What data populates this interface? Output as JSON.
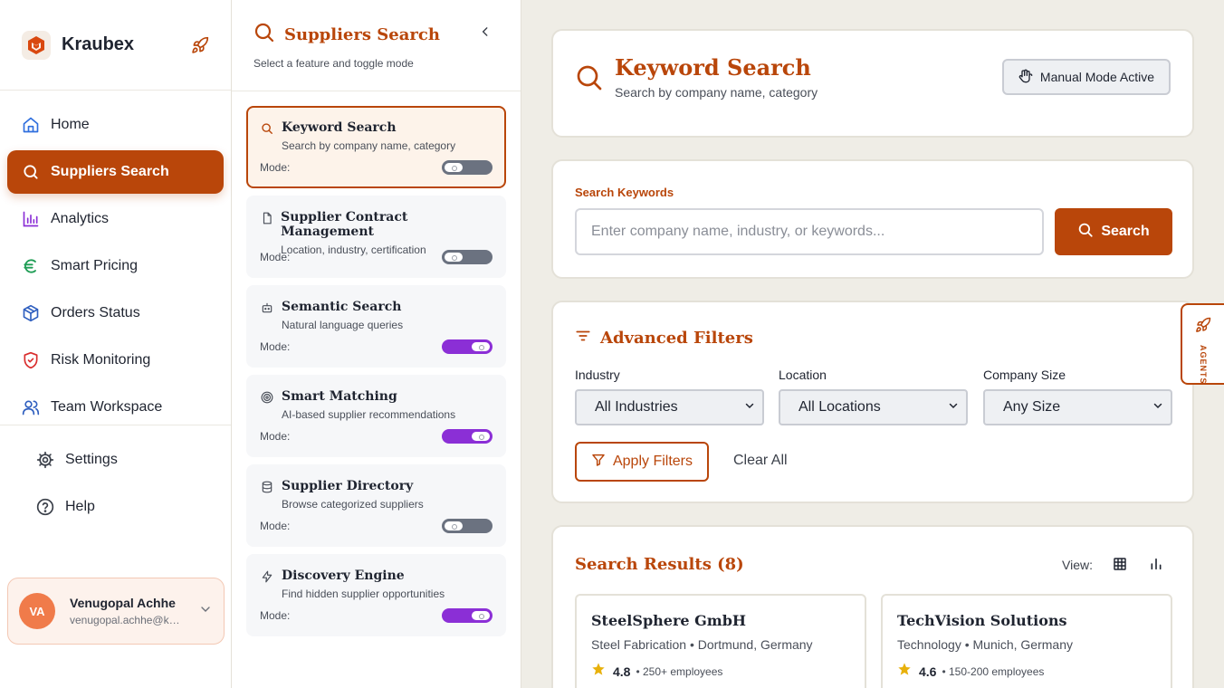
{
  "app": {
    "name": "Kraubex"
  },
  "sidebar": {
    "items": [
      {
        "label": "Home",
        "icon": "home-icon"
      },
      {
        "label": "Suppliers Search",
        "icon": "search-icon",
        "active": true
      },
      {
        "label": "Analytics",
        "icon": "bar-chart-icon"
      },
      {
        "label": "Smart Pricing",
        "icon": "euro-icon"
      },
      {
        "label": "Orders Status",
        "icon": "package-icon"
      },
      {
        "label": "Risk Monitoring",
        "icon": "shield-alert-icon"
      },
      {
        "label": "Team Workspace",
        "icon": "users-icon"
      }
    ],
    "bottom_items": [
      {
        "label": "Settings",
        "icon": "gear-icon"
      },
      {
        "label": "Help",
        "icon": "help-circle-icon"
      }
    ],
    "user": {
      "initials": "VA",
      "name": "Venugopal Achhe",
      "email": "venugopal.achhe@kraubex.com"
    }
  },
  "feature_panel": {
    "title": "Suppliers Search",
    "subtitle": "Select a feature and toggle mode",
    "mode_label": "Mode:",
    "features": [
      {
        "title": "Keyword Search",
        "desc": "Search by company name, category",
        "icon": "search-icon",
        "mode_on": false,
        "active": true
      },
      {
        "title": "Supplier Contract Management",
        "desc": "Location, industry, certification",
        "icon": "document-icon",
        "mode_on": false
      },
      {
        "title": "Semantic Search",
        "desc": "Natural language queries",
        "icon": "bot-icon",
        "mode_on": true
      },
      {
        "title": "Smart Matching",
        "desc": "AI-based supplier recommendations",
        "icon": "target-icon",
        "mode_on": true
      },
      {
        "title": "Supplier Directory",
        "desc": "Browse categorized suppliers",
        "icon": "database-icon",
        "mode_on": false
      },
      {
        "title": "Discovery Engine",
        "desc": "Find hidden supplier opportunities",
        "icon": "lightning-icon",
        "mode_on": true
      }
    ]
  },
  "header": {
    "title": "Keyword Search",
    "subtitle": "Search by company name, category",
    "mode_button": "Manual Mode Active"
  },
  "search": {
    "label": "Search Keywords",
    "placeholder": "Enter company name, industry, or keywords...",
    "button": "Search"
  },
  "filters": {
    "title": "Advanced Filters",
    "fields": [
      {
        "label": "Industry",
        "value": "All Industries"
      },
      {
        "label": "Location",
        "value": "All Locations"
      },
      {
        "label": "Company Size",
        "value": "Any Size"
      }
    ],
    "apply": "Apply Filters",
    "clear": "Clear All"
  },
  "results": {
    "title": "Search Results (8)",
    "view_label": "View:",
    "items": [
      {
        "name": "SteelSphere GmbH",
        "meta": "Steel Fabrication • Dortmund, Germany",
        "rating": "4.8",
        "employees": "• 250+ employees"
      },
      {
        "name": "TechVision Solutions",
        "meta": "Technology • Munich, Germany",
        "rating": "4.6",
        "employees": "• 150-200 employees"
      }
    ]
  },
  "agents_tab": {
    "label": "AGENTS"
  },
  "colors": {
    "accent": "#b9460a",
    "toggle_on": "#8b2fd6",
    "toggle_off": "#6b7280",
    "star": "#e8b10c"
  }
}
